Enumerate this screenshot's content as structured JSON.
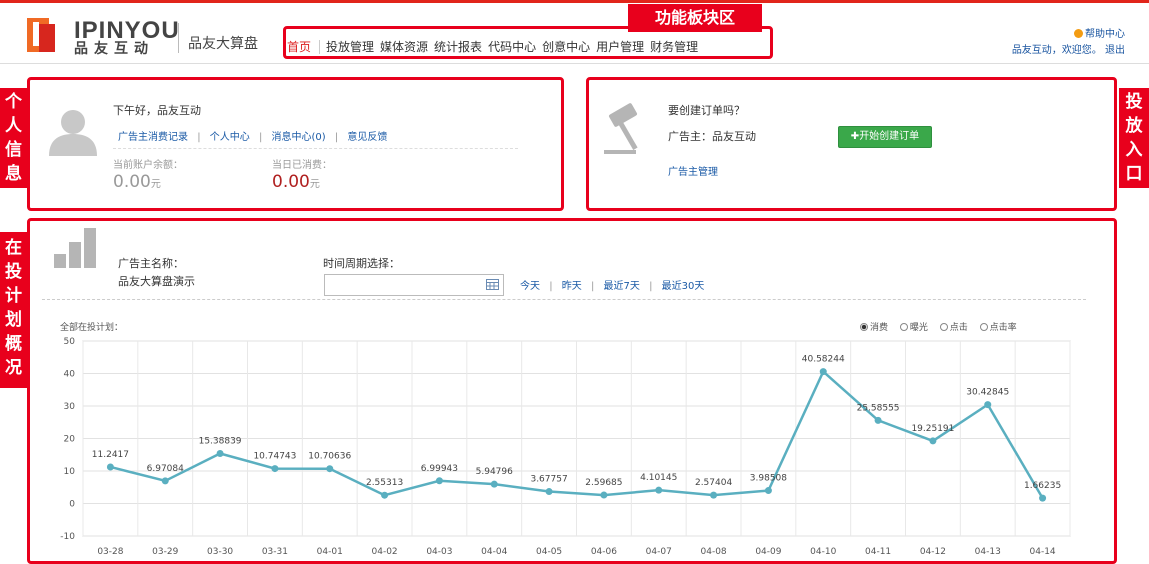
{
  "header": {
    "logo_text": "IPINYOU",
    "logo_cn": "品友互动",
    "product": "品友大算盘",
    "nav": [
      "首页",
      "投放管理",
      "媒体资源",
      "统计报表",
      "代码中心",
      "创意中心",
      "用户管理",
      "财务管理"
    ],
    "help": "帮助中心",
    "user": "品友互动",
    "welcome": "欢迎您",
    "logout": "退出"
  },
  "annotations": {
    "function_area": "功能板块区",
    "personal_info": "个人信息",
    "entry": "投放入口",
    "plan_overview": "在投计划概况"
  },
  "profile": {
    "greeting": "下午好，品友互动",
    "links": [
      "广告主消费记录",
      "个人中心",
      "消息中心(0)",
      "意见反馈"
    ],
    "balance_label": "当前账户余额：",
    "balance_value": "0.00",
    "balance_unit": "元",
    "spent_label": "当日已消费：",
    "spent_value": "0.00",
    "spent_unit": "元"
  },
  "order": {
    "question": "要创建订单吗？",
    "advertiser": "广告主：品友互动",
    "create_button": "开始创建订单",
    "manage_link": "广告主管理"
  },
  "plan": {
    "advertiser_label": "广告主名称：",
    "advertiser_name": "品友大算盘演示",
    "period_label": "时间周期选择：",
    "date_input_value": "",
    "ranges": [
      "今天",
      "昨天",
      "最近7天",
      "最近30天"
    ],
    "chart_title": "全部在投计划：",
    "metrics": [
      {
        "label": "消费",
        "selected": true
      },
      {
        "label": "曝光",
        "selected": false
      },
      {
        "label": "点击",
        "selected": false
      },
      {
        "label": "点击率",
        "selected": false
      }
    ]
  },
  "colors": {
    "accent": "#e8001c",
    "line": "#5aafc0",
    "green": "#3aa84a",
    "link": "#1a5aa6"
  },
  "chart_data": {
    "type": "line",
    "categories": [
      "03-28",
      "03-29",
      "03-30",
      "03-31",
      "04-01",
      "04-02",
      "04-03",
      "04-04",
      "04-05",
      "04-06",
      "04-07",
      "04-08",
      "04-09",
      "04-10",
      "04-11",
      "04-12",
      "04-13",
      "04-14"
    ],
    "series": [
      {
        "values": [
          11.2417,
          6.97084,
          15.38839,
          10.74743,
          10.70636,
          2.55313,
          6.99943,
          5.94796,
          3.67757,
          2.59685,
          4.10145,
          2.57404,
          3.98508,
          40.58244,
          25.58555,
          19.25191,
          30.42845,
          1.66235
        ]
      }
    ],
    "labels": [
      "11.2417",
      "6.97084",
      "15.38839",
      "10.74743",
      "10.70636",
      "2.55313",
      "6.99943",
      "5.94796",
      "3.67757",
      "2.59685",
      "4.10145",
      "2.57404",
      "3.98508",
      "40.58244",
      "25.58555",
      "19.25191",
      "30.42845",
      "1.66235"
    ],
    "y_ticks": [
      "50",
      "40",
      "30",
      "20",
      "10",
      "0",
      "-10"
    ],
    "ylim": [
      -10,
      50
    ],
    "grid": true
  }
}
